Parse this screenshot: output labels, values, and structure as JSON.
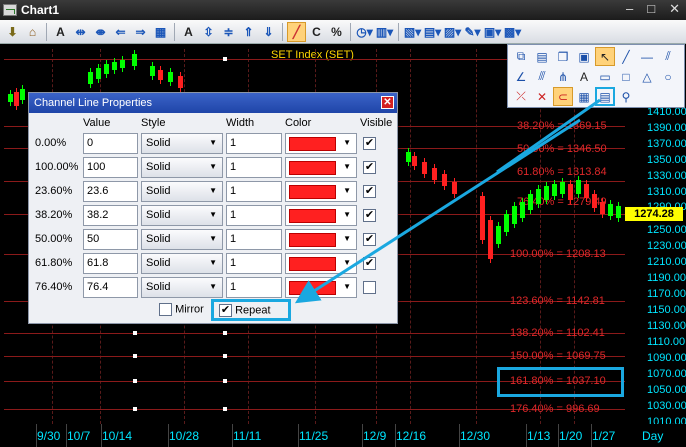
{
  "window": {
    "title": "Chart1"
  },
  "toolbar": {
    "percent_label": "%"
  },
  "chart": {
    "title": "SET Index (SET)",
    "price_labels": [
      "1410.00",
      "1390.00",
      "1370.00",
      "1350.00",
      "1330.00",
      "1310.00",
      "1290.00",
      "1270.00",
      "1250.00",
      "1230.00",
      "1210.00",
      "1190.00",
      "1170.00",
      "1150.00",
      "1130.00",
      "1110.00",
      "1090.00",
      "1070.00",
      "1050.00",
      "1030.00",
      "1010.00"
    ],
    "current_price": "1274.28",
    "date_labels": [
      "9/30",
      "10/7",
      "10/14",
      "10/28",
      "11/11",
      "11/25",
      "12/9",
      "12/16",
      "12/30",
      "1/13",
      "1/20",
      "1/27"
    ],
    "period_label": "Day",
    "fib_labels": [
      "38.20% = 1369.15",
      "50.00% = 1346.50",
      "61.80% = 1313.84",
      "76.40% = 1279.49",
      "100.00% = 1208.13",
      "123.60% = 1142.81",
      "138.20% = 1102.41",
      "150.00% = 1069.75",
      "161.80% = 1037.10",
      "176.40% = 996.69"
    ]
  },
  "dialog": {
    "title": "Channel Line Properties",
    "headers": {
      "value": "Value",
      "style": "Style",
      "width": "Width",
      "color": "Color",
      "visible": "Visible"
    },
    "rows": [
      {
        "label": "0.00%",
        "value": "0",
        "style": "Solid",
        "width": "1",
        "color": "#ff2020",
        "visible": true
      },
      {
        "label": "100.00%",
        "value": "100",
        "style": "Solid",
        "width": "1",
        "color": "#ff2020",
        "visible": true
      },
      {
        "label": "23.60%",
        "value": "23.6",
        "style": "Solid",
        "width": "1",
        "color": "#ff2020",
        "visible": true
      },
      {
        "label": "38.20%",
        "value": "38.2",
        "style": "Solid",
        "width": "1",
        "color": "#ff2020",
        "visible": true
      },
      {
        "label": "50.00%",
        "value": "50",
        "style": "Solid",
        "width": "1",
        "color": "#ff2020",
        "visible": true
      },
      {
        "label": "61.80%",
        "value": "61.8",
        "style": "Solid",
        "width": "1",
        "color": "#ff2020",
        "visible": true
      },
      {
        "label": "76.40%",
        "value": "76.4",
        "style": "Solid",
        "width": "1",
        "color": "#ff2020",
        "visible": false
      }
    ],
    "mirror_label": "Mirror",
    "repeat_label": "Repeat",
    "mirror_checked": false,
    "repeat_checked": true
  },
  "colors": {
    "accent": "#1aa8e0",
    "axis_text": "#00e5ff",
    "fib_line": "#e0282a",
    "candle_up": "#00ff00",
    "candle_down": "#ff2020"
  }
}
